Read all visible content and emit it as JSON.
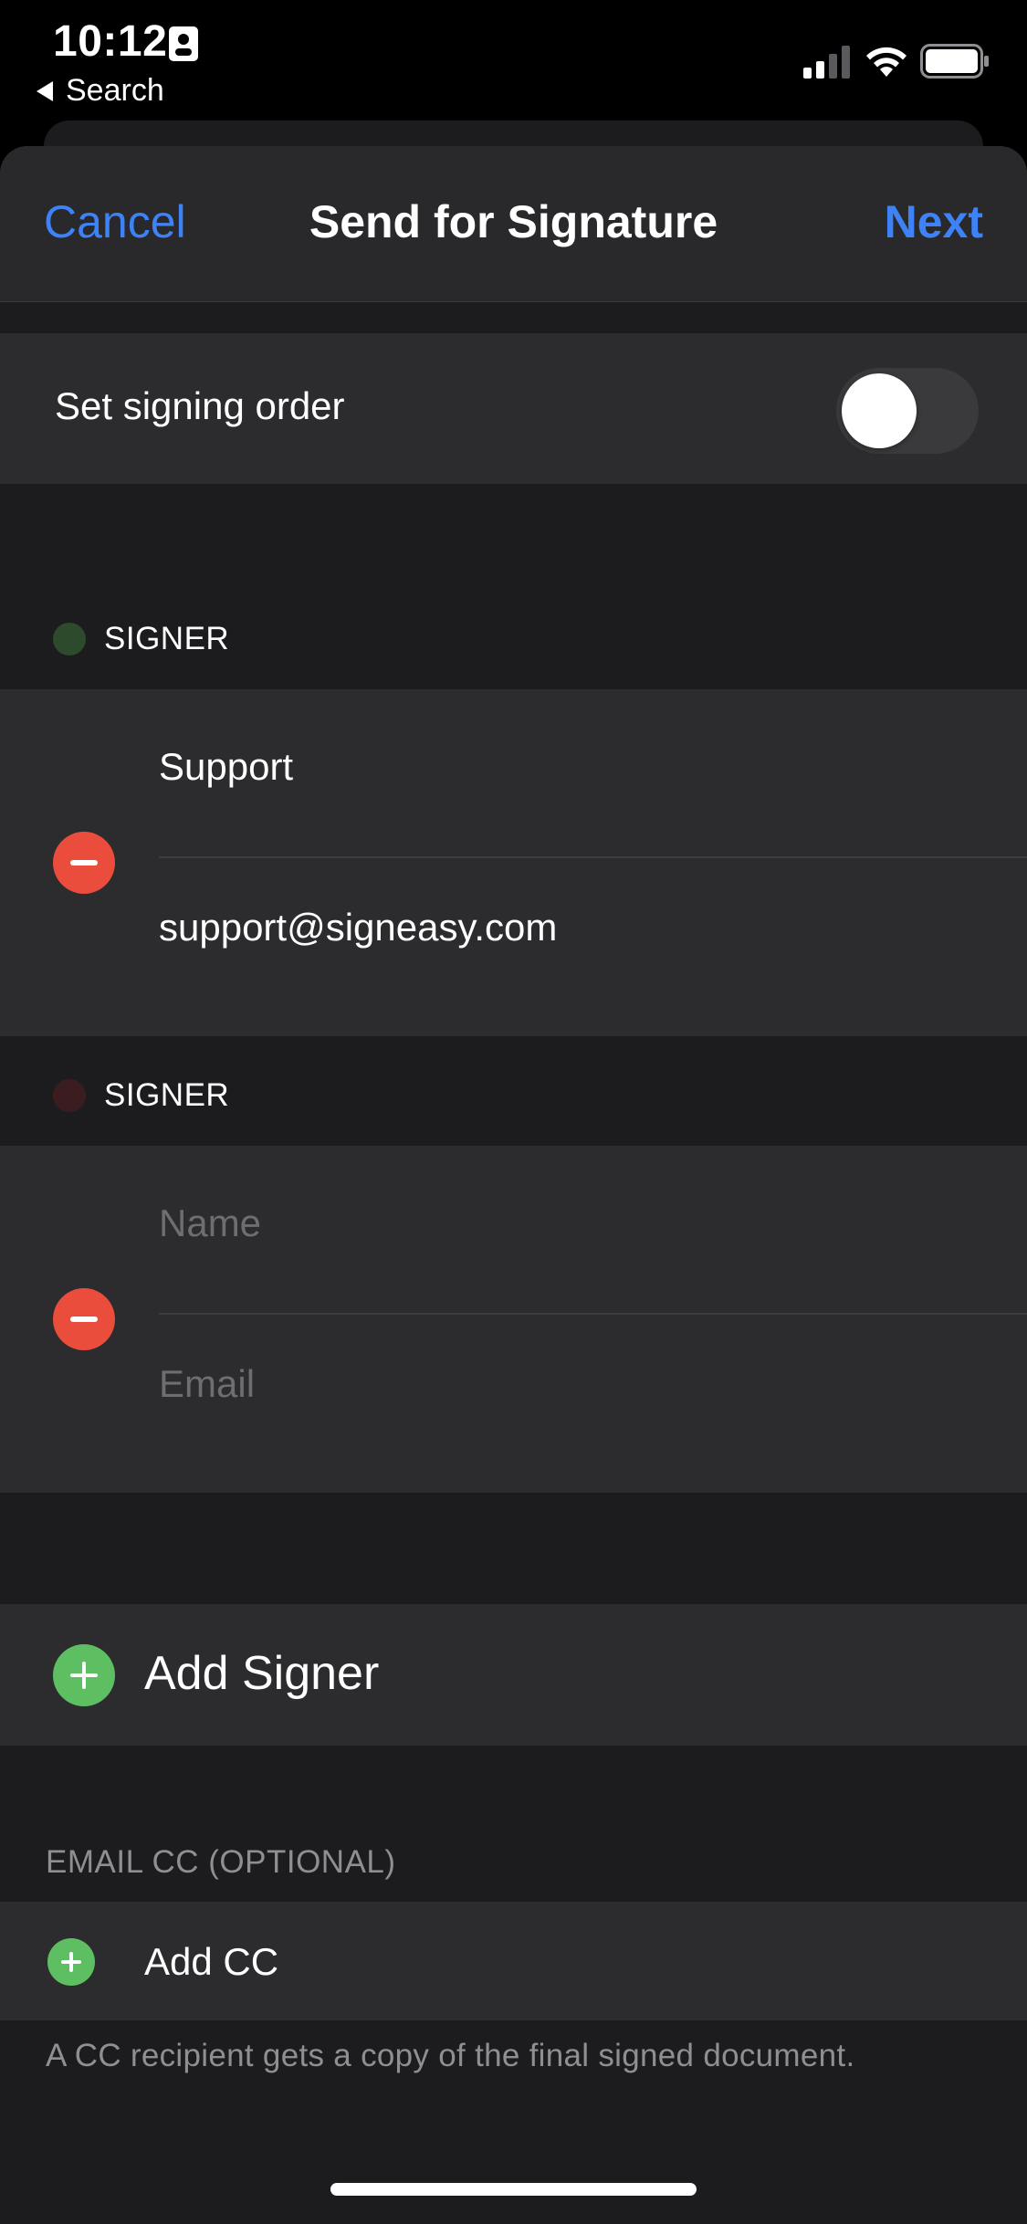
{
  "status_bar": {
    "time": "10:12",
    "back_label": "Search",
    "icons": [
      "contact-card-icon",
      "cellular-signal-icon",
      "wifi-icon",
      "battery-icon"
    ]
  },
  "nav": {
    "cancel_label": "Cancel",
    "title": "Send for Signature",
    "next_label": "Next"
  },
  "signing_order": {
    "label": "Set signing order",
    "enabled": false
  },
  "signers": [
    {
      "header": "SIGNER",
      "dot_color": "#2d4a2c",
      "name_value": "Support",
      "name_placeholder": "Name",
      "email_value": "support@signeasy.com",
      "email_placeholder": "Email"
    },
    {
      "header": "SIGNER",
      "dot_color": "#3b1d1f",
      "name_value": "",
      "name_placeholder": "Name",
      "email_value": "",
      "email_placeholder": "Email"
    }
  ],
  "add_signer": {
    "label": "Add Signer"
  },
  "cc": {
    "header": "EMAIL CC (OPTIONAL)",
    "add_label": "Add CC",
    "footnote": "A CC recipient gets a copy of the final signed document."
  },
  "colors": {
    "accent": "#3e82f7",
    "remove": "#eb4d3d",
    "add": "#5dbf61",
    "sheet_bg": "#1c1c1e",
    "panel_bg": "#2c2c2e"
  }
}
